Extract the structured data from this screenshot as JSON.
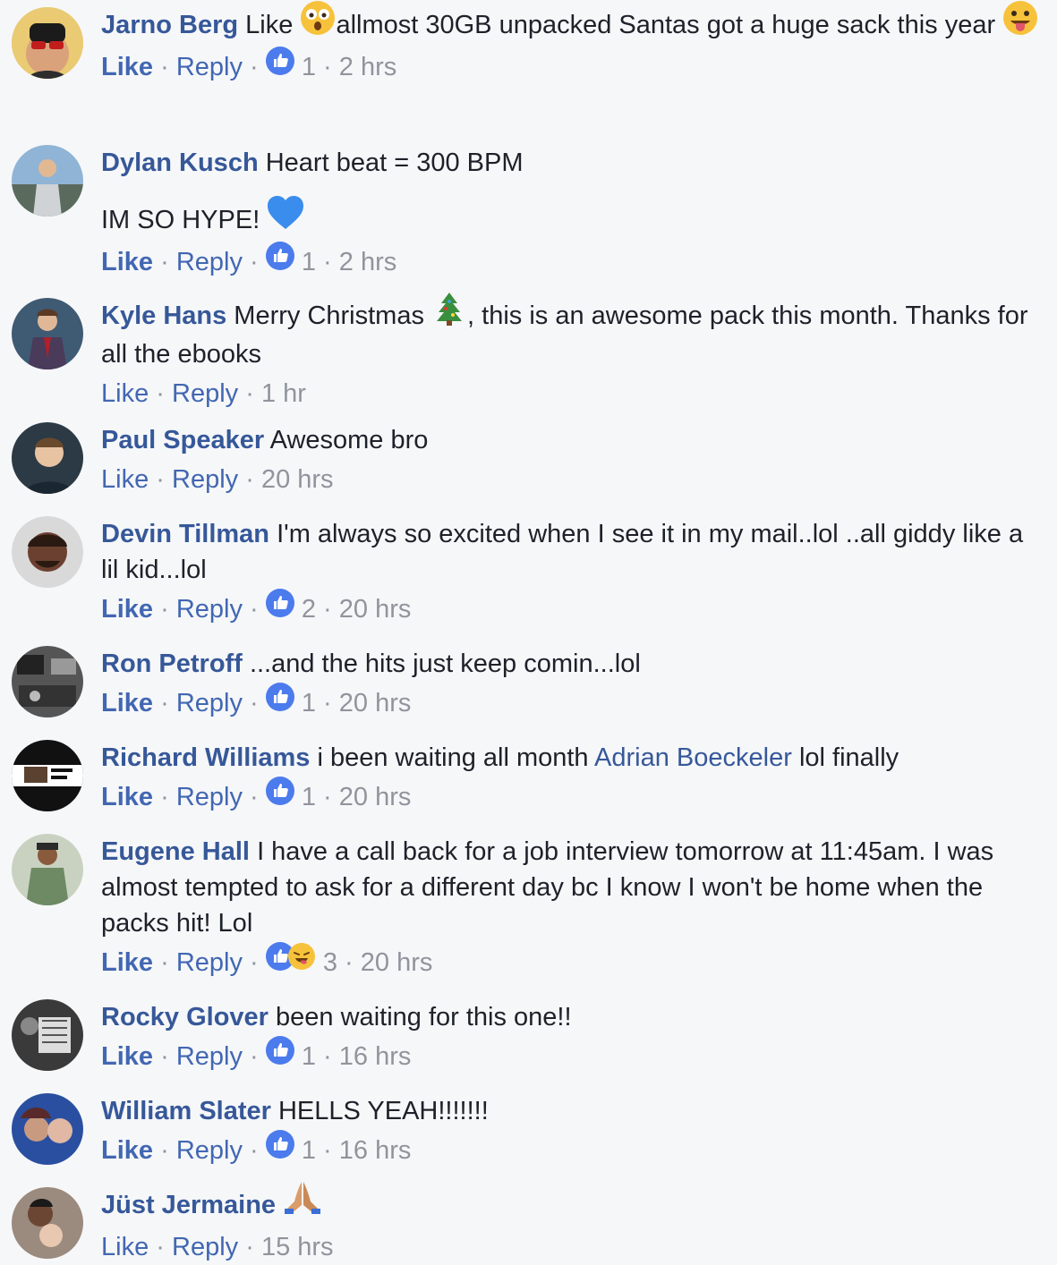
{
  "colors": {
    "author": "#365899",
    "action": "#4267b2",
    "meta": "#90949c",
    "like_badge": "#4b7bec",
    "background": "#f6f7f9"
  },
  "separator": "·",
  "comments": [
    {
      "author": "Jarno Berg",
      "text_before": "Like",
      "emoji_inline": "astonished-face-emoji",
      "text_after": "allmost 30GB unpacked Santas got a huge sack this year",
      "emoji_trailing": "tongue-out-face-emoji",
      "like": "Like",
      "reply": "Reply",
      "reaction_count": "1",
      "time": "2 hrs",
      "reactions": [
        "like-reaction-icon"
      ]
    },
    {
      "author": "Dylan Kusch",
      "text": "Heart beat = 300 BPM",
      "text2": "IM SO HYPE!",
      "emoji_trailing": "blue-heart-emoji",
      "like": "Like",
      "reply": "Reply",
      "reaction_count": "1",
      "time": "2 hrs",
      "reactions": [
        "like-reaction-icon"
      ]
    },
    {
      "author": "Kyle Hans",
      "text_before": "Merry Christmas",
      "emoji_inline": "christmas-tree-emoji",
      "text_after": ", this is an awesome pack this month. Thanks for all the ebooks",
      "like": "Like",
      "reply": "Reply",
      "time": "1 hr"
    },
    {
      "author": "Paul Speaker",
      "text": "Awesome bro",
      "like": "Like",
      "reply": "Reply",
      "time": "20 hrs"
    },
    {
      "author": "Devin Tillman",
      "text": "I'm always so excited when I see it in my mail..lol ..all giddy like a lil kid...lol",
      "like": "Like",
      "reply": "Reply",
      "reaction_count": "2",
      "time": "20 hrs",
      "reactions": [
        "like-reaction-icon"
      ]
    },
    {
      "author": "Ron Petroff",
      "text": "...and the hits just keep comin...lol",
      "like": "Like",
      "reply": "Reply",
      "reaction_count": "1",
      "time": "20 hrs",
      "reactions": [
        "like-reaction-icon"
      ]
    },
    {
      "author": "Richard Williams",
      "text_before": "i been waiting all month",
      "mention": "Adrian Boeckeler",
      "text_after": "lol finally",
      "like": "Like",
      "reply": "Reply",
      "reaction_count": "1",
      "time": "20 hrs",
      "reactions": [
        "like-reaction-icon"
      ]
    },
    {
      "author": "Eugene Hall",
      "text": "I have a call back for a job interview tomorrow at 11:45am. I was almost tempted to ask for a different day bc I know I won't be home when the packs hit! Lol",
      "like": "Like",
      "reply": "Reply",
      "reaction_count": "3",
      "time": "20 hrs",
      "reactions": [
        "like-reaction-icon",
        "haha-wink-reaction-icon"
      ]
    },
    {
      "author": "Rocky Glover",
      "text": "been waiting for this one!!",
      "like": "Like",
      "reply": "Reply",
      "reaction_count": "1",
      "time": "16 hrs",
      "reactions": [
        "like-reaction-icon"
      ]
    },
    {
      "author": "William Slater",
      "text": "HELLS YEAH!!!!!!!",
      "like": "Like",
      "reply": "Reply",
      "reaction_count": "1",
      "time": "16 hrs",
      "reactions": [
        "like-reaction-icon"
      ]
    },
    {
      "author": "Jüst Jermaine",
      "emoji_trailing": "folded-hands-emoji",
      "like": "Like",
      "reply": "Reply",
      "time": "15 hrs"
    }
  ]
}
